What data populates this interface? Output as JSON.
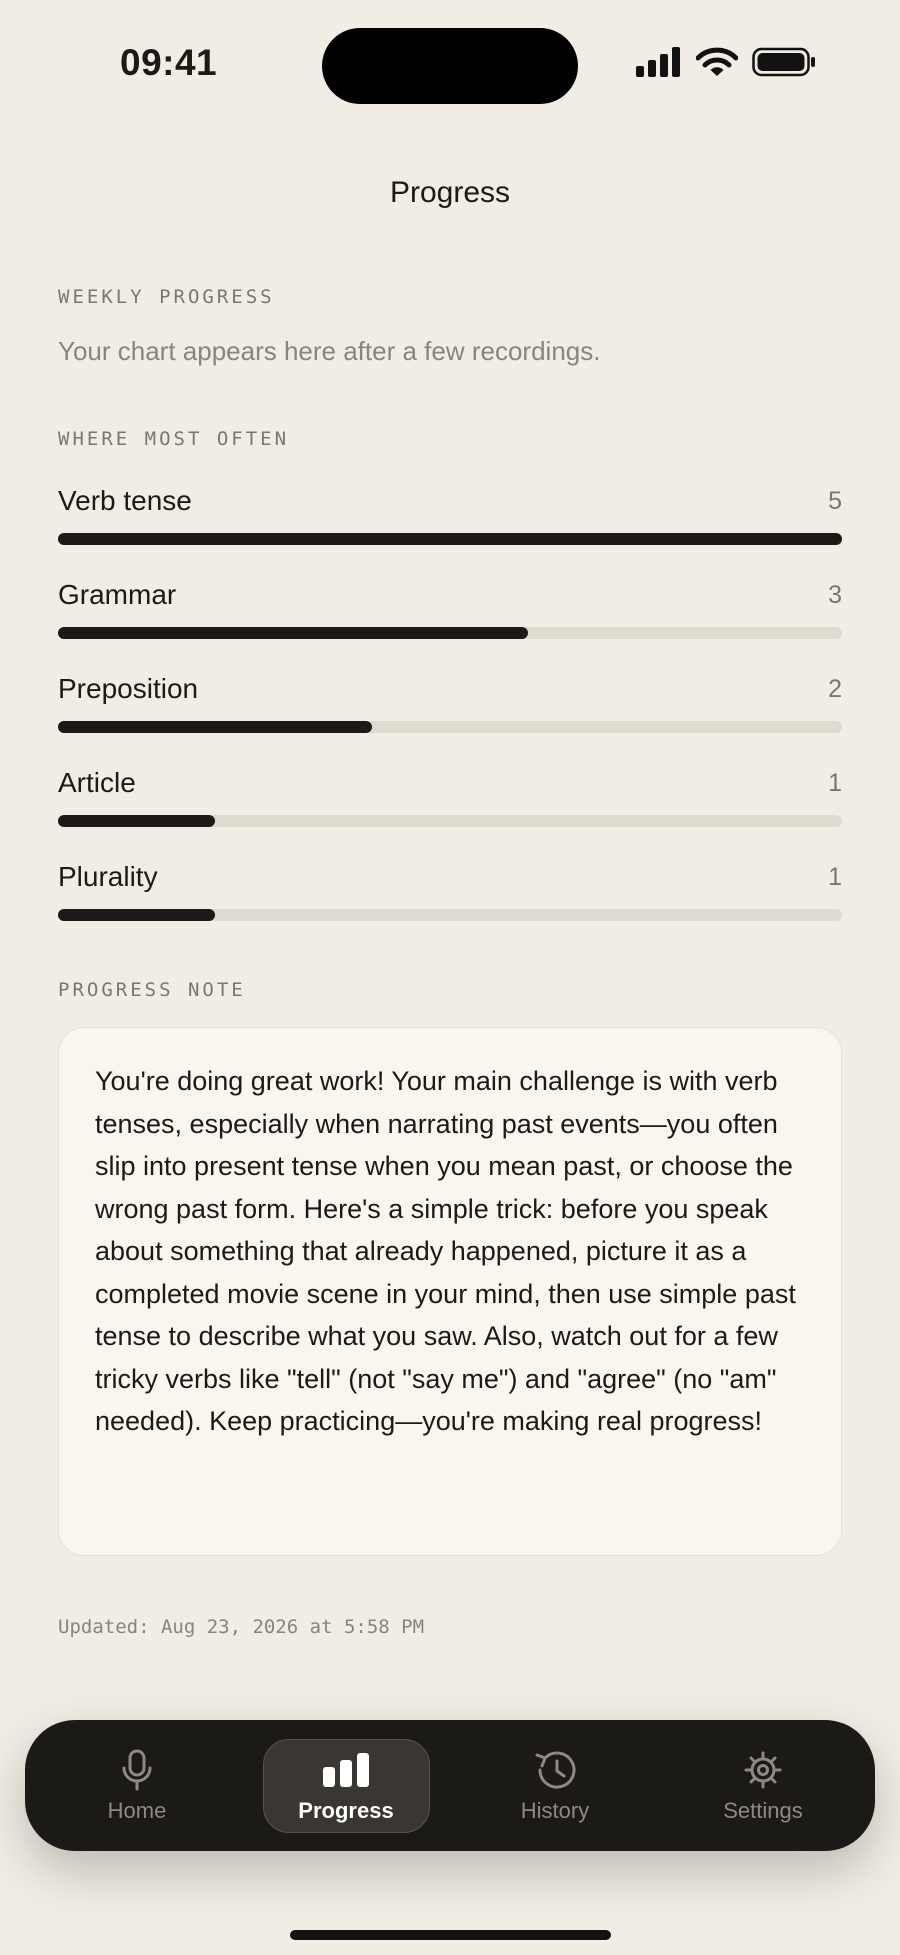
{
  "status_bar": {
    "time": "09:41"
  },
  "header": {
    "title": "Progress"
  },
  "weekly_progress": {
    "label": "WEEKLY PROGRESS",
    "empty_text": "Your chart appears here after a few recordings."
  },
  "where_most_often": {
    "label": "WHERE MOST OFTEN",
    "max_count": 5,
    "items": [
      {
        "label": "Verb tense",
        "count": "5"
      },
      {
        "label": "Grammar",
        "count": "3"
      },
      {
        "label": "Preposition",
        "count": "2"
      },
      {
        "label": "Article",
        "count": "1"
      },
      {
        "label": "Plurality",
        "count": "1"
      }
    ]
  },
  "progress_note": {
    "label": "PROGRESS NOTE",
    "text": "You're doing great work! Your main challenge is with verb tenses, especially when narrating past events—you often slip into present tense when you mean past, or choose the wrong past form. Here's a simple trick: before you speak about something that already happened, picture it as a completed movie scene in your mind, then use simple past tense to describe what you saw. Also, watch out for a few tricky verbs like \"tell\" (not \"say me\") and \"agree\" (no \"am\" needed). Keep practicing—you're making real progress!"
  },
  "updated_text": "Updated: Aug 23, 2026 at 5:58 PM",
  "tab_bar": {
    "active": "progress",
    "tabs": [
      {
        "id": "home",
        "label": "Home",
        "icon": "microphone-icon"
      },
      {
        "id": "progress",
        "label": "Progress",
        "icon": "bar-chart-icon"
      },
      {
        "id": "history",
        "label": "History",
        "icon": "history-icon"
      },
      {
        "id": "settings",
        "label": "Settings",
        "icon": "gear-icon"
      }
    ]
  },
  "colors": {
    "background": "#f1ede4",
    "text": "#1c1a17",
    "muted": "#7c766c",
    "bar_fill": "#1c1a17",
    "bar_track": "#e0dbd1",
    "card": "#f9f6ef",
    "tab_bar": "#1c1a17"
  }
}
